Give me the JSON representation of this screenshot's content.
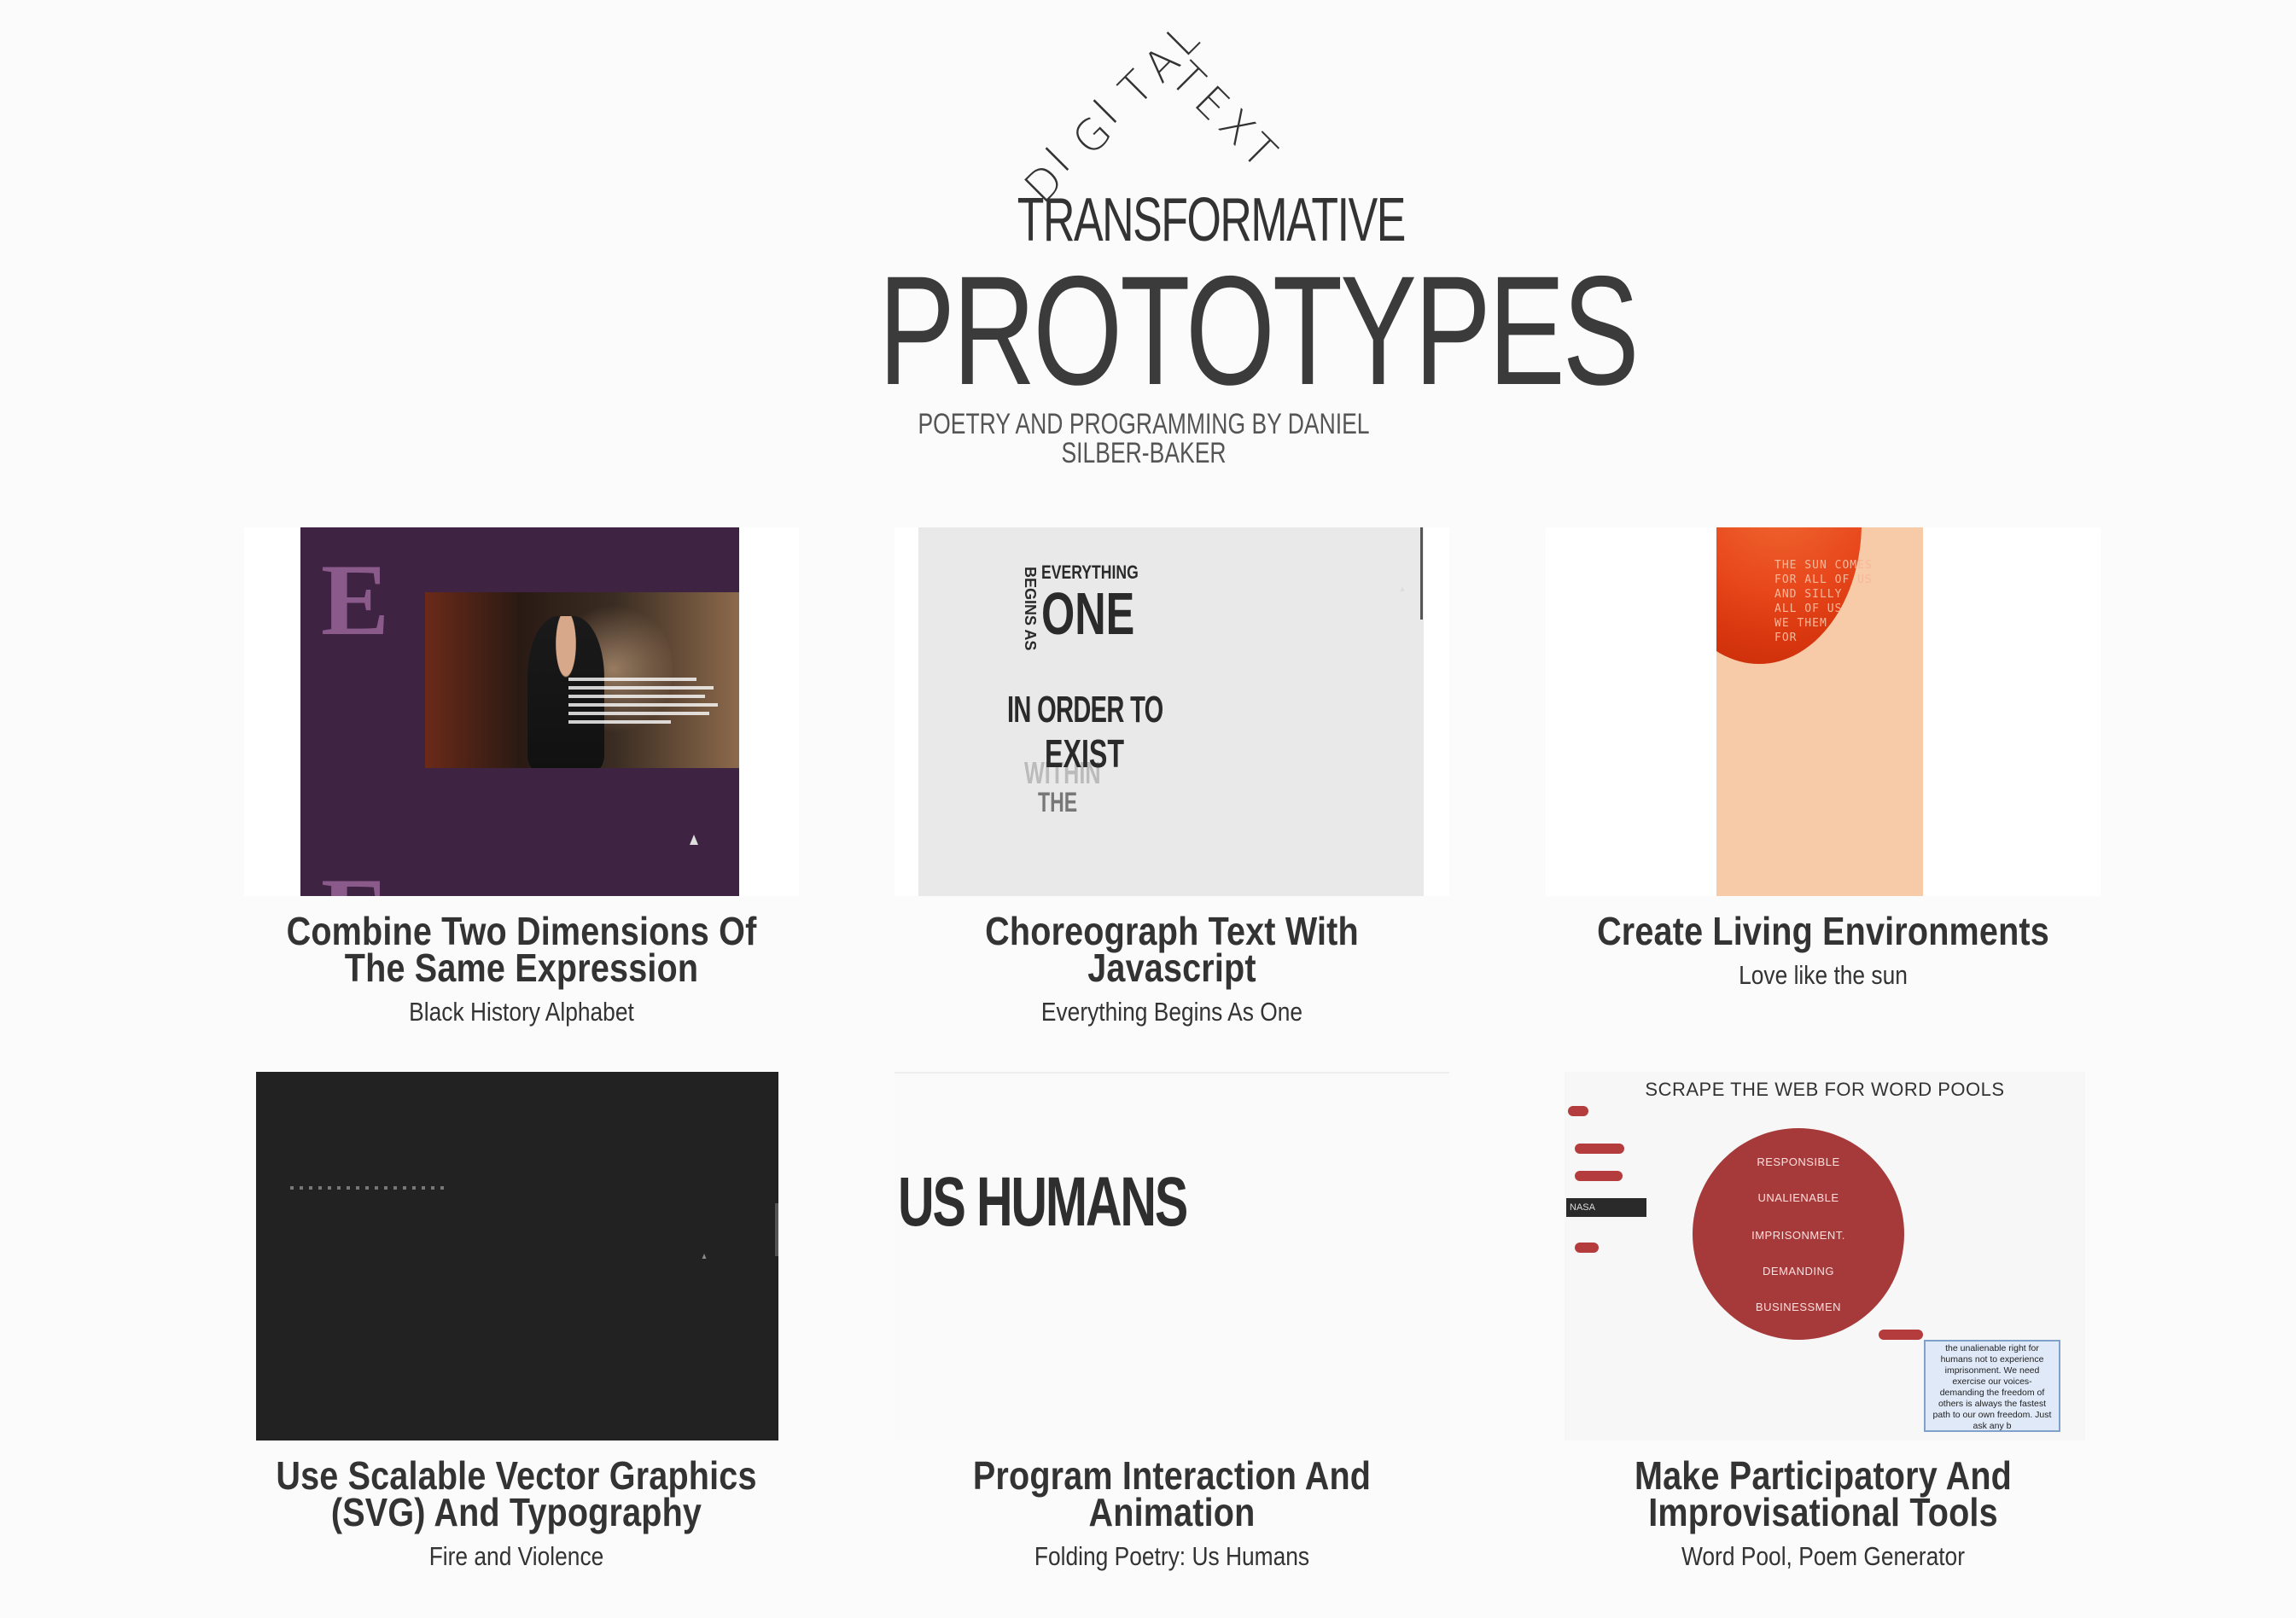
{
  "header": {
    "arc_left": "DIGITAL",
    "arc_right": "TEXT",
    "supertitle": "TRANSFORMATIVE",
    "title": "PROTOTYPES",
    "byline": "POETRY AND PROGRAMMING BY DANIEL SILBER-BAKER"
  },
  "cards": [
    {
      "title": "Combine Two Dimensions Of The Same Expression",
      "subtitle": "Black History Alphabet",
      "thumb": {
        "letter": "E"
      }
    },
    {
      "title": "Choreograph Text With Javascript",
      "subtitle": "Everything Begins As One",
      "thumb": {
        "everything": "EVERYTHING",
        "begins_as": "BEGINS AS",
        "one": "ONE",
        "in_order_to": "IN ORDER TO",
        "exist": "EXIST",
        "within": "WITHIN",
        "the": "THE"
      }
    },
    {
      "title": "Create Living Environments",
      "subtitle": "Love like the sun",
      "thumb": {
        "lines": [
          "THE SUN COMES",
          "FOR ALL OF US",
          "AND SILLY",
          "ALL OF US",
          "WE THEM",
          "FOR"
        ]
      }
    },
    {
      "title": "Use Scalable Vector Graphics (SVG) And Typography",
      "subtitle": "Fire and Violence",
      "thumb": {}
    },
    {
      "title": "Program Interaction And Animation",
      "subtitle": "Folding Poetry: Us Humans",
      "thumb": {
        "text": "US HUMANS"
      }
    },
    {
      "title": "Make Participatory And Improvisational Tools",
      "subtitle": "Word Pool, Poem Generator",
      "thumb": {
        "heading": "SCRAPE THE WEB FOR WORD POOLS",
        "words": [
          "RESPONSIBLE",
          "UNALIENABLE",
          "IMPRISONMENT.",
          "DEMANDING",
          "BUSINESSMEN"
        ],
        "input_value": "NASA",
        "poem": "the unalienable right for humans not to experience imprisonment. We need exercise our voices- demanding the freedom of others is always the fastest path to our own freedom. Just ask any b"
      }
    }
  ],
  "colors": {
    "background": "#fbfbfb",
    "text": "#333333",
    "alphabet_purple": "#3e2343",
    "sun_peach": "#f7caa8",
    "sun_orange": "#e8481c",
    "wordpool_red": "#a63a3a"
  }
}
